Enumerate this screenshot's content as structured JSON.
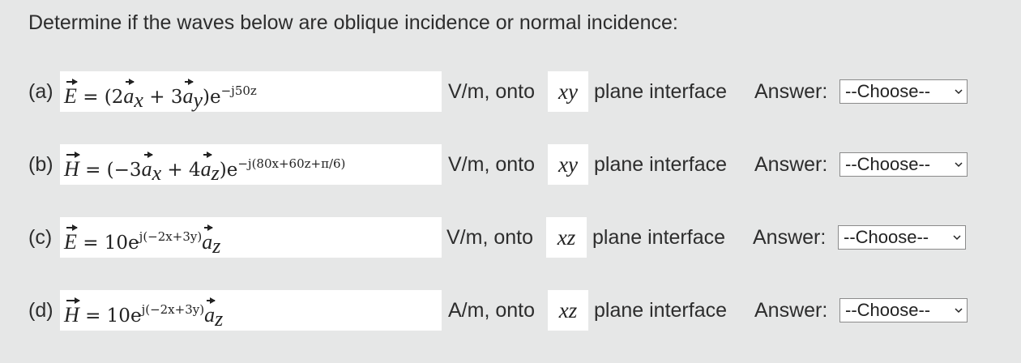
{
  "prompt": "Determine if the waves below are oblique incidence or normal incidence:",
  "rows": [
    {
      "label": "(a)",
      "field": "E",
      "unit": "V/m, onto",
      "plane": "xy",
      "plane_text": "plane interface",
      "answer_label": "Answer:",
      "select_value": "--Choose--"
    },
    {
      "label": "(b)",
      "field": "H",
      "unit": "V/m, onto",
      "plane": "xy",
      "plane_text": "plane interface",
      "answer_label": "Answer:",
      "select_value": "--Choose--"
    },
    {
      "label": "(c)",
      "field": "E",
      "unit": "V/m, onto",
      "plane": "xz",
      "plane_text": "plane interface",
      "answer_label": "Answer:",
      "select_value": "--Choose--"
    },
    {
      "label": "(d)",
      "field": "H",
      "unit": "A/m, onto",
      "plane": "xz",
      "plane_text": "plane interface",
      "answer_label": "Answer:",
      "select_value": "--Choose--"
    }
  ],
  "equations": {
    "a": {
      "lhs": "E",
      "body_pre": " = (2",
      "a1": "a",
      "s1": "x",
      "mid": " + 3",
      "a2": "a",
      "s2": "y",
      "close": ")e",
      "exp": "−j50z"
    },
    "b": {
      "lhs": "H",
      "body_pre": " = (−3",
      "a1": "a",
      "s1": "x",
      "mid": " + 4",
      "a2": "a",
      "s2": "z",
      "close": ")e",
      "exp": "−j(80x+60z+π/6)"
    },
    "c": {
      "lhs": "E",
      "body_pre": " = 10e",
      "exp": "j(−2x+3y)",
      "a1": "a",
      "s1": "z"
    },
    "d": {
      "lhs": "H",
      "body_pre": " = 10e",
      "exp": "j(−2x+3y)",
      "a1": "a",
      "s1": "z"
    }
  }
}
